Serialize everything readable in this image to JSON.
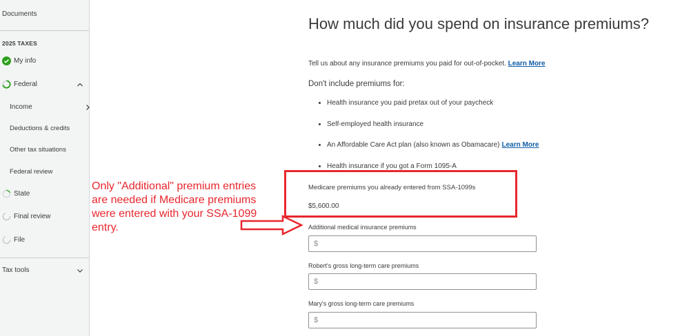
{
  "sidebar": {
    "documents": "Documents",
    "taxes_heading": "2025 TAXES",
    "my_info": "My info",
    "federal": "Federal",
    "income": "Income",
    "deductions": "Deductions & credits",
    "other": "Other tax situations",
    "federal_review": "Federal review",
    "state": "State",
    "final_review": "Final review",
    "file": "File",
    "tax_tools": "Tax tools"
  },
  "main": {
    "title": "How much did you spend on insurance premiums?",
    "intro": "Tell us about any insurance premiums you paid for out-of-pocket.",
    "learn_more": "Learn More",
    "dont_include": "Don't include premiums for:",
    "bullets": [
      "Health insurance you paid pretax out of your paycheck",
      "Self-employed health insurance",
      "An Affordable Care Act plan (also known as Obamacare)",
      "Health insurance if you got a Form 1095-A"
    ],
    "bullet3_link": "Learn More",
    "medicare_label": "Medicare premiums you already entered from SSA-1099s",
    "medicare_value": "$5,600.00",
    "fields": [
      {
        "label": "Additional medical insurance premiums",
        "placeholder": "$"
      },
      {
        "label": "Robert's gross long-term care premiums",
        "placeholder": "$"
      },
      {
        "label": "Mary's gross long-term care premiums",
        "placeholder": "$"
      }
    ]
  },
  "annotation": {
    "text": "Only \"Additional\" premium entries are needed if Medicare premiums were entered with your SSA-1099 entry."
  },
  "colors": {
    "accent_red": "#e8262d",
    "link_blue": "#0d5ca6",
    "check_green": "#2ca01c"
  }
}
